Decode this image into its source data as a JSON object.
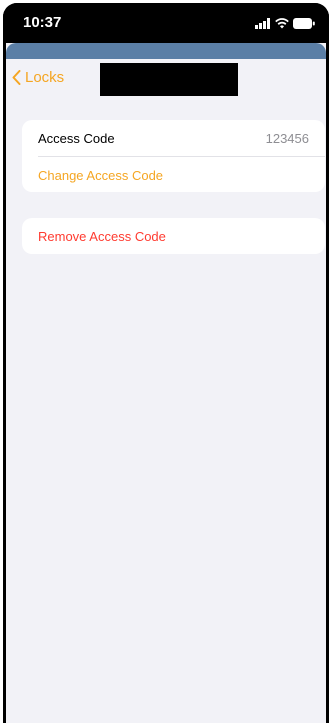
{
  "status_bar": {
    "time": "10:37",
    "icons": [
      "cellular-signal-icon",
      "wifi-icon",
      "battery-icon"
    ]
  },
  "nav": {
    "back_label": "Locks",
    "back_icon": "chevron-left-icon",
    "title_redacted": true
  },
  "access_code_section": {
    "label": "Access Code",
    "value": "123456",
    "change_label": "Change Access Code"
  },
  "remove_section": {
    "remove_label": "Remove Access Code"
  },
  "colors": {
    "accent": "#f5a623",
    "destructive": "#ff3b30",
    "background": "#f2f2f7",
    "header_strip": "#5b7fa6"
  }
}
